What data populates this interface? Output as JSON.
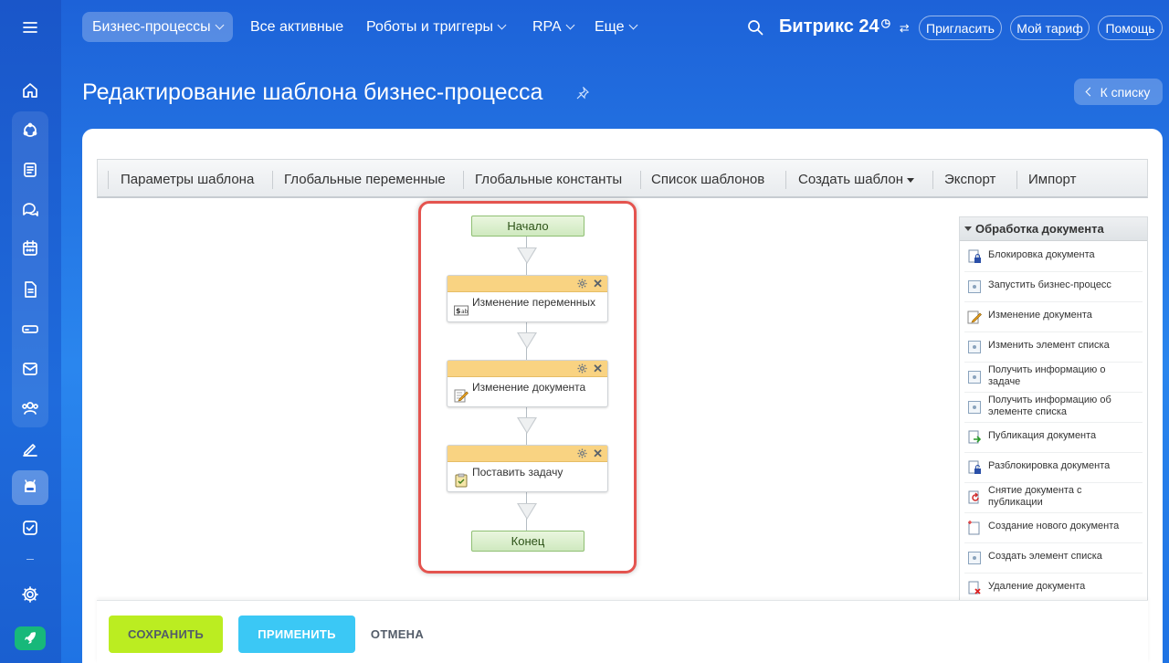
{
  "topnav": {
    "items": [
      {
        "label": "Бизнес-процессы",
        "dropdown": true,
        "active": true
      },
      {
        "label": "Все активные",
        "dropdown": false
      },
      {
        "label": "Роботы и триггеры",
        "dropdown": true
      },
      {
        "label": "RPA",
        "dropdown": true
      },
      {
        "label": "Еще",
        "dropdown": true
      }
    ],
    "logo_text": "Битрикс 24",
    "invite_label": "Пригласить",
    "tariff_label": "Мой тариф",
    "help_label": "Помощь"
  },
  "sidebar": {
    "icons": [
      "menu-icon",
      "home-icon",
      "crm-icon",
      "feed-icon",
      "chat-icon",
      "calendar-icon",
      "document-icon",
      "storage-icon",
      "mail-icon",
      "users-icon",
      "sign-icon",
      "bot-icon",
      "tasks-icon",
      "settings-icon",
      "rocket-icon"
    ]
  },
  "page": {
    "title": "Редактирование шаблона бизнес-процесса",
    "back_label": "К списку"
  },
  "toolbar": {
    "items": [
      "Параметры шаблона",
      "Глобальные переменные",
      "Глобальные константы",
      "Список шаблонов",
      "Создать шаблон",
      "Экспорт",
      "Импорт"
    ]
  },
  "flow": {
    "start_label": "Начало",
    "end_label": "Конец",
    "activities": [
      {
        "label": "Изменение переменных",
        "icon": "variables-icon"
      },
      {
        "label": "Изменение документа",
        "icon": "edit-document-icon"
      },
      {
        "label": "Поставить задачу",
        "icon": "task-icon"
      }
    ]
  },
  "panel": {
    "title": "Обработка документа",
    "items": [
      {
        "label": "Блокировка документа",
        "icon": "lock-document-icon"
      },
      {
        "label": "Запустить бизнес-процесс",
        "icon": "generic-activity-icon"
      },
      {
        "label": "Изменение документа",
        "icon": "edit-document-icon"
      },
      {
        "label": "Изменить элемент списка",
        "icon": "generic-activity-icon"
      },
      {
        "label": "Получить информацию о задаче",
        "icon": "generic-activity-icon"
      },
      {
        "label": "Получить информацию об элементе списка",
        "icon": "generic-activity-icon"
      },
      {
        "label": "Публикация документа",
        "icon": "publish-document-icon"
      },
      {
        "label": "Разблокировка документа",
        "icon": "unlock-document-icon"
      },
      {
        "label": "Снятие документа с публикации",
        "icon": "unpublish-document-icon"
      },
      {
        "label": "Создание нового документа",
        "icon": "new-document-icon"
      },
      {
        "label": "Создать элемент списка",
        "icon": "generic-activity-icon"
      },
      {
        "label": "Удаление документа",
        "icon": "delete-document-icon"
      }
    ]
  },
  "footer": {
    "save_label": "СОХРАНИТЬ",
    "apply_label": "ПРИМЕНИТЬ",
    "cancel_label": "ОТМЕНА"
  },
  "colors": {
    "save": "#bbed21",
    "apply": "#3bc8f5",
    "highlight": "#e4544f",
    "activity_header": "#f9d382"
  }
}
